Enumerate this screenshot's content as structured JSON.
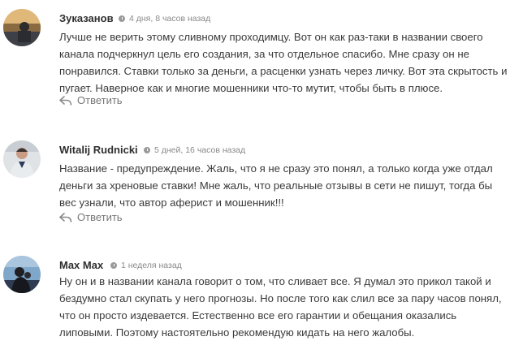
{
  "comments": [
    {
      "author": "Зуказанов",
      "time": "4 дня, 8 часов назад",
      "text": "Лучше не верить этому сливному проходимцу. Вот он как раз-таки в названии своего канала подчеркнул цель его создания, за что отдельное спасибо. Мне сразу он не понравился. Ставки только за деньги, а расценки узнать через личку. Вот эта скрытость и пугает. Наверное как и многие мошенники что-то мутит, чтобы быть в плюсе.",
      "reply": "Ответить"
    },
    {
      "author": "Witalij Rudnicki",
      "time": "5 дней, 16 часов назад",
      "text": "Название - предупреждение. Жаль, что я не сразу это понял, а только когда уже отдал деньги за хреновые ставки! Мне жаль, что реальные отзывы в сети не пишут, тогда бы вес узнали, что автор аферист и мошенник!!!",
      "reply": "Ответить"
    },
    {
      "author": "Max Max",
      "time": "1 неделя назад",
      "text": "Ну он и в названии канала говорит о том, что сливает все. Я думал это прикол такой и бездумно стал скупать у него прогнозы. Но после того как слил все за пару часов понял, что он просто издевается. Естественно все его гарантии и обещания оказались липовыми. Поэтому настоятельно рекомендую кидать на него жалобы."
    }
  ],
  "icons": {
    "avatar": "user-avatar",
    "time": "clock-icon",
    "reply": "reply-arrow-icon"
  }
}
